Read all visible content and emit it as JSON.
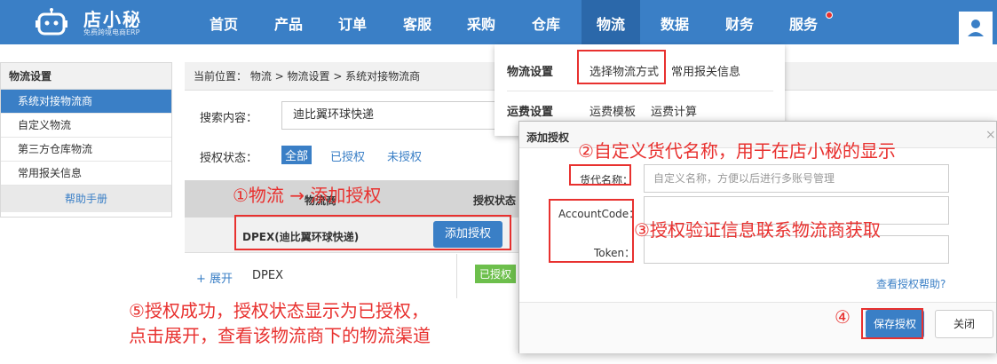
{
  "nav": {
    "logo_name": "店小秘",
    "logo_sub": "免费跨境电商ERP",
    "items": [
      "首页",
      "产品",
      "订单",
      "客服",
      "采购",
      "仓库",
      "物流",
      "数据",
      "财务",
      "服务"
    ],
    "active_item": "物流",
    "accent": "#3a7fc6",
    "user_icon": "user-icon"
  },
  "sidebar": {
    "title": "物流设置",
    "items": [
      "系统对接物流商",
      "自定义物流",
      "第三方仓库物流",
      "常用报关信息"
    ],
    "active": "系统对接物流商",
    "help": "帮助手册"
  },
  "main": {
    "breadcrumb": "当前位置：  物流 >  物流设置 > 系统对接物流商",
    "search_label": "搜索内容：",
    "search_value": "迪比翼环球快递",
    "auth_label": "授权状态：",
    "filters": [
      "全部",
      "已授权",
      "未授权"
    ],
    "col_carrier": "物流商",
    "col_status": "授权状态",
    "carrier_name": "DPEX(迪比翼环球快递)",
    "add_auth": "添加授权",
    "expand": "+ 展开",
    "dpex": "DPEX",
    "status_badge": "已授权"
  },
  "dropdown": {
    "group1": "物流设置",
    "group1_items": [
      "选择物流方式",
      "常用报关信息"
    ],
    "group2": "运费设置",
    "group2_items": [
      "运费模板",
      "运费计算"
    ]
  },
  "modal": {
    "title": "添加授权",
    "close": "×",
    "alias_label": "货代名称：",
    "alias_placeholder": "自定义名称，方便以后进行多账号管理",
    "account_label": "AccountCode：",
    "token_label": "Token：",
    "help_link": "查看授权帮助?",
    "save": "保存授权",
    "cancel": "关闭"
  },
  "annotations": {
    "a1": "①物流 → 添加授权",
    "a2": "②自定义货代名称，用于在店小秘的显示",
    "a3": "③授权验证信息联系物流商获取",
    "a4": "④",
    "a5_line1": "⑤授权成功，授权状态显示为已授权，",
    "a5_line2": "点击展开，查看该物流商下的物流渠道",
    "color": "#e8312f"
  }
}
